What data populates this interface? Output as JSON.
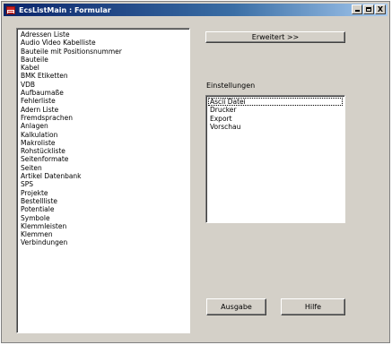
{
  "window": {
    "title": "EcsListMain : Formular",
    "controls": {
      "minimize": "_",
      "maximize": "□",
      "close": "X"
    }
  },
  "main_list": {
    "items": [
      "Adressen Liste",
      "Audio Video Kabelliste",
      "Bauteile mit Positionsnummer",
      "Bauteile",
      "Kabel",
      "BMK Etiketten",
      "VDB",
      "Aufbaumaße",
      "Fehlerliste",
      "Adern Liste",
      "Fremdsprachen",
      "Anlagen",
      "Kalkulation",
      "Makroliste",
      "Rohstückliste",
      "Seitenformate",
      "Seiten",
      "Artikel Datenbank",
      "SPS",
      "Projekte",
      "Bestellliste",
      "Potentiale",
      "Symbole",
      "Klemmleisten",
      "Klemmen",
      "Verbindungen"
    ]
  },
  "buttons": {
    "erweitert": "Erweitert >>",
    "ausgabe": "Ausgabe",
    "hilfe": "Hilfe"
  },
  "settings": {
    "label": "Einstellungen",
    "items": [
      "Ascii Datei",
      "Drucker",
      "Export",
      "Vorschau"
    ]
  }
}
